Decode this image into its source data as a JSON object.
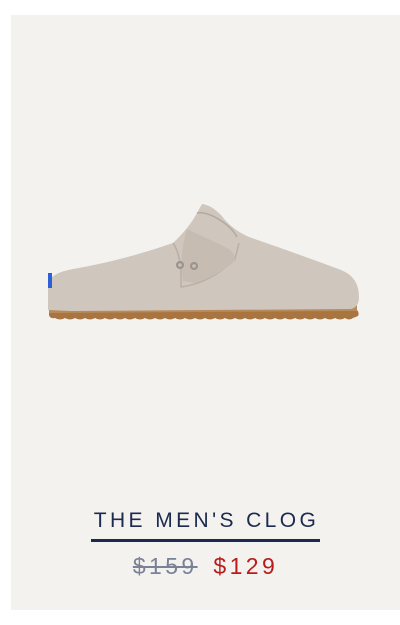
{
  "product": {
    "name": "THE MEN'S CLOG",
    "price_original": "$159",
    "price_sale": "$129",
    "image_icon": "clog-shoe-image"
  },
  "colors": {
    "card_background": "#f3f2ef",
    "name_color": "#1b2a4e",
    "original_price_color": "#7a8296",
    "sale_price_color": "#b71c1c",
    "shoe_upper": "#cfc6bd",
    "shoe_sole": "#a8743f",
    "heel_tab": "#2f5fd6"
  }
}
